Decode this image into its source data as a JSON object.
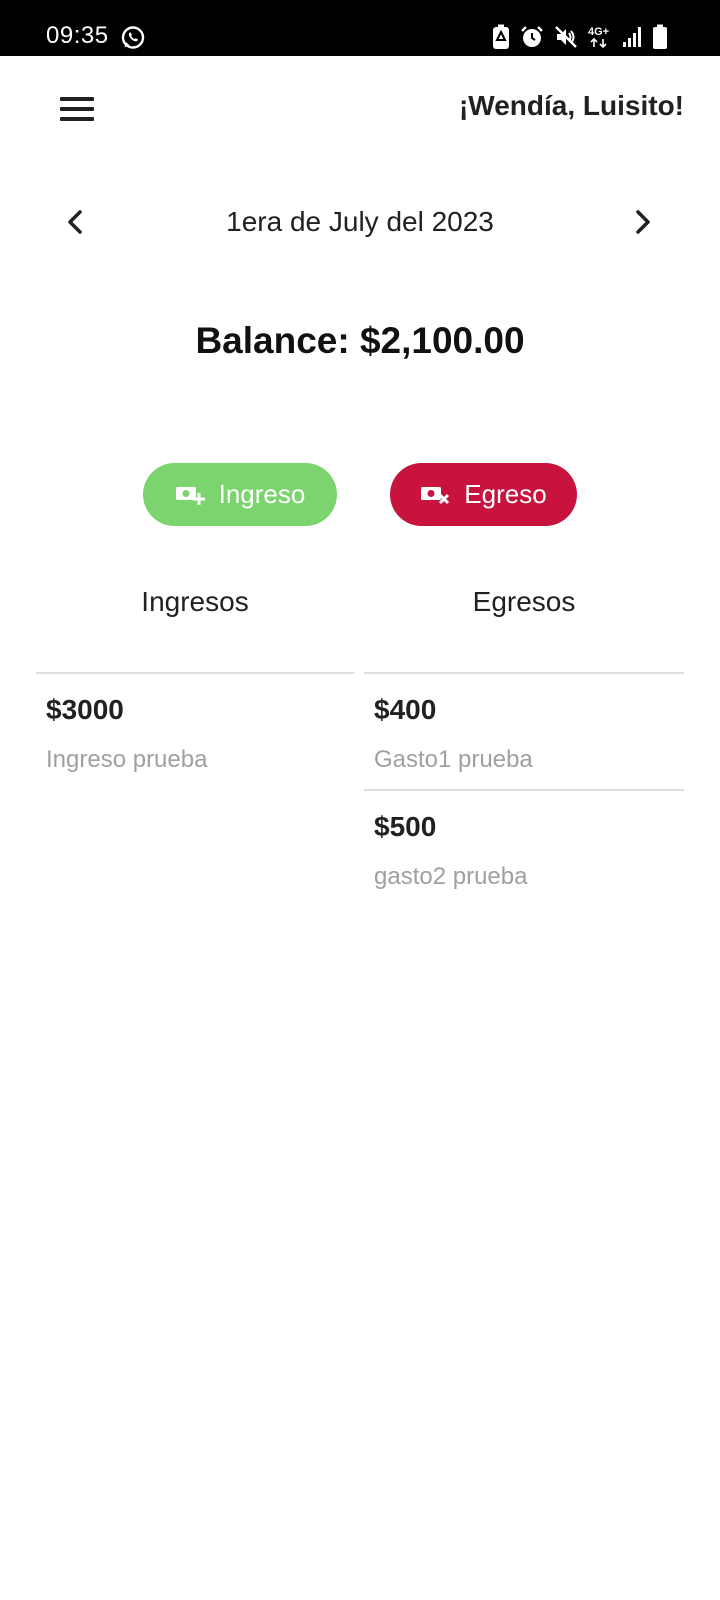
{
  "status_bar": {
    "time": "09:35",
    "icons": [
      "whatsapp-icon",
      "battery-saver-icon",
      "alarm-icon",
      "mute-icon",
      "4g-plus-icon",
      "signal-icon",
      "battery-icon"
    ],
    "network_label": "4G+"
  },
  "header": {
    "menu_icon": "hamburger-menu-icon",
    "greeting": "¡Wendía, Luisito!"
  },
  "date_nav": {
    "prev_icon": "chevron-left-icon",
    "label": "1era de July del 2023",
    "next_icon": "chevron-right-icon"
  },
  "balance": {
    "text": "Balance: $2,100.00"
  },
  "actions": {
    "ingreso": {
      "label": "Ingreso",
      "icon": "money-add-icon",
      "color": "#7bd46d"
    },
    "egreso": {
      "label": "Egreso",
      "icon": "money-remove-icon",
      "color": "#c8133f"
    }
  },
  "columns": {
    "ingresos": {
      "title": "Ingresos",
      "items": [
        {
          "amount": "$3000",
          "description": "Ingreso prueba"
        }
      ]
    },
    "egresos": {
      "title": "Egresos",
      "items": [
        {
          "amount": "$400",
          "description": "Gasto1 prueba"
        },
        {
          "amount": "$500",
          "description": "gasto2 prueba"
        }
      ]
    }
  }
}
